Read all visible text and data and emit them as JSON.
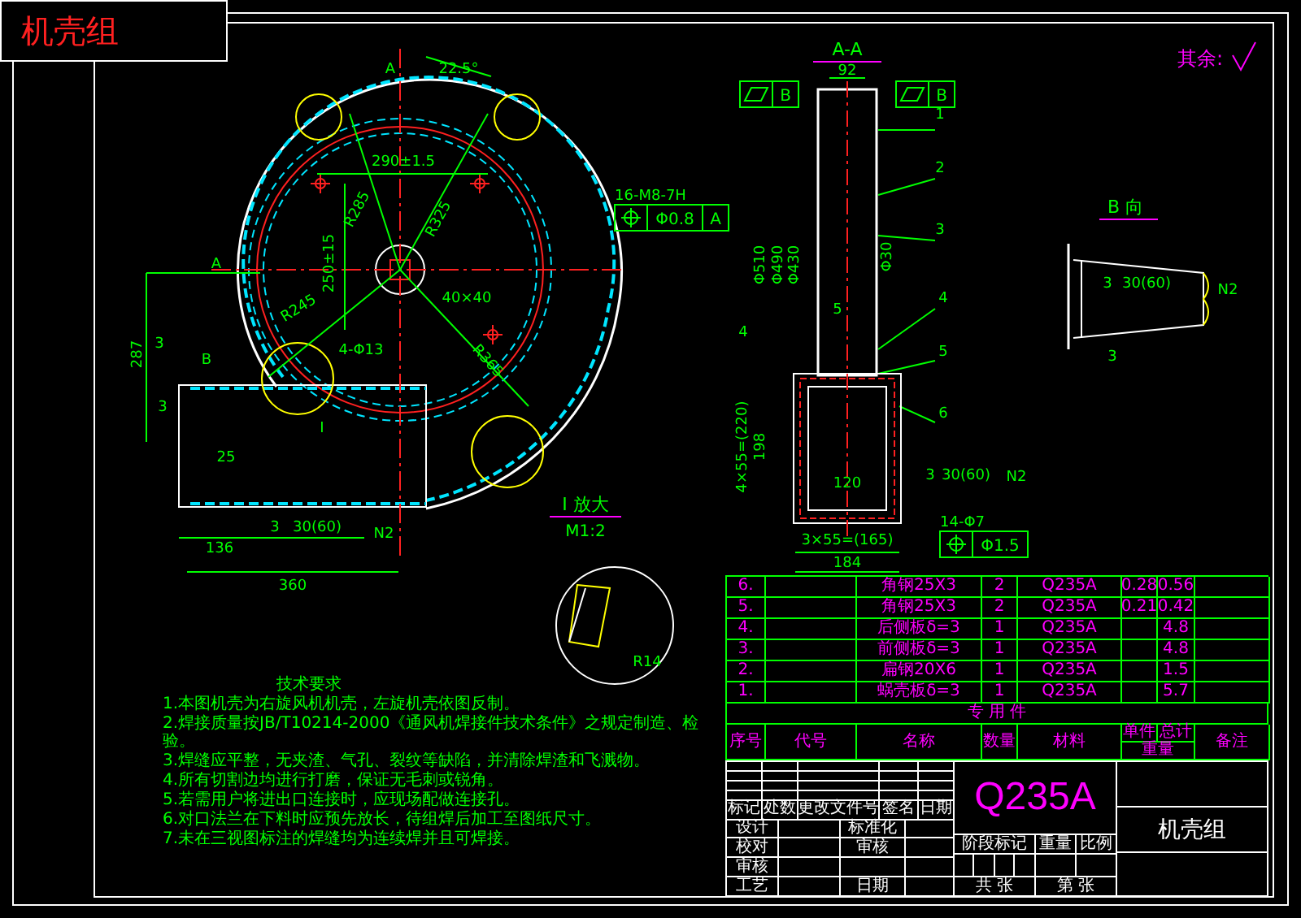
{
  "title_tag": "机壳组",
  "roughness_note": {
    "label": "其余:"
  },
  "main_view": {
    "labels": [
      "A",
      "22.5°",
      "290±1.5",
      "R285",
      "R325",
      "250±15",
      "R245",
      "40×40",
      "R365",
      "4-Φ13",
      "A",
      "287",
      "3",
      "B",
      "3",
      "25",
      "136",
      "360",
      "3",
      "30(60)",
      "N2",
      "I"
    ]
  },
  "section_view": {
    "title": "A-A",
    "labels": [
      "92",
      "1",
      "2",
      "3",
      "4",
      "5",
      "6",
      "Φ510",
      "Φ490",
      "Φ430",
      "Φ30",
      "5",
      "4",
      "120",
      "4×55=(220)",
      "198",
      "3",
      "30(60)",
      "N2",
      "3×55=(165)",
      "184"
    ]
  },
  "b_view": {
    "title": "B 向",
    "labels": [
      "3",
      "30(60)",
      "N2",
      "3"
    ]
  },
  "detail_view": {
    "title": "I 放大",
    "scale": "M1:2",
    "labels": [
      "R14"
    ]
  },
  "tolerance_frames": [
    {
      "kind": "position",
      "note": "16-M8-7H",
      "cells": [
        "Φ0.8",
        "A"
      ]
    },
    {
      "kind": "flatness",
      "cells": [
        "B"
      ]
    },
    {
      "kind": "flatness",
      "cells": [
        "B"
      ]
    },
    {
      "kind": "position",
      "note": "14-Φ7",
      "cells": [
        "Φ1.5"
      ]
    }
  ],
  "technical_requirements": {
    "title": "技术要求",
    "items": [
      "1.本图机壳为右旋风机机壳，左旋机壳依图反制。",
      "2.焊接质量按JB/T10214-2000《通风机焊接件技术条件》之规定制造、检验。",
      "3.焊缝应平整，无夹渣、气孔、裂纹等缺陷，并清除焊渣和飞溅物。",
      "4.所有切割边均进行打磨，保证无毛刺或锐角。",
      "5.若需用户将进出口连接时，应现场配做连接孔。",
      "6.对口法兰在下料时应预先放长，待组焊后加工至图纸尺寸。",
      "7.未在三视图标注的焊缝均为连续焊并且可焊接。"
    ]
  },
  "parts_table": {
    "rows": [
      {
        "no": "6.",
        "name": "角钢25X3",
        "qty": "2",
        "material": "Q235A",
        "unit_weight": "0.28",
        "total_weight": "0.56"
      },
      {
        "no": "5.",
        "name": "角钢25X3",
        "qty": "2",
        "material": "Q235A",
        "unit_weight": "0.21",
        "total_weight": "0.42"
      },
      {
        "no": "4.",
        "name": "后侧板δ=3",
        "qty": "1",
        "material": "Q235A",
        "total_weight": "4.8"
      },
      {
        "no": "3.",
        "name": "前侧板δ=3",
        "qty": "1",
        "material": "Q235A",
        "total_weight": "4.8"
      },
      {
        "no": "2.",
        "name": "扁钢20X6",
        "qty": "1",
        "material": "Q235A",
        "total_weight": "1.5"
      },
      {
        "no": "1.",
        "name": "蜗壳板δ=3",
        "qty": "1",
        "material": "Q235A",
        "total_weight": "5.7"
      }
    ],
    "group_label": "专 用 件",
    "headers": {
      "no": "序号",
      "code": "代号",
      "name": "名称",
      "qty": "数量",
      "material": "材料",
      "unit": "单件",
      "total": "总计",
      "weight": "重量",
      "remark": "备注"
    }
  },
  "title_block": {
    "material": "Q235A",
    "name": "机壳组",
    "revision_labels": [
      "标记",
      "处数",
      "更改文件号",
      "签名",
      "日期"
    ],
    "sign_rows": [
      [
        "设计",
        "标准化"
      ],
      [
        "校对",
        "审核"
      ],
      [
        "审核",
        ""
      ],
      [
        "工艺",
        "日期"
      ]
    ],
    "stage_labels": [
      "阶段标记",
      "重量",
      "比例"
    ],
    "sheet_labels": [
      "共 张",
      "第 张"
    ]
  }
}
